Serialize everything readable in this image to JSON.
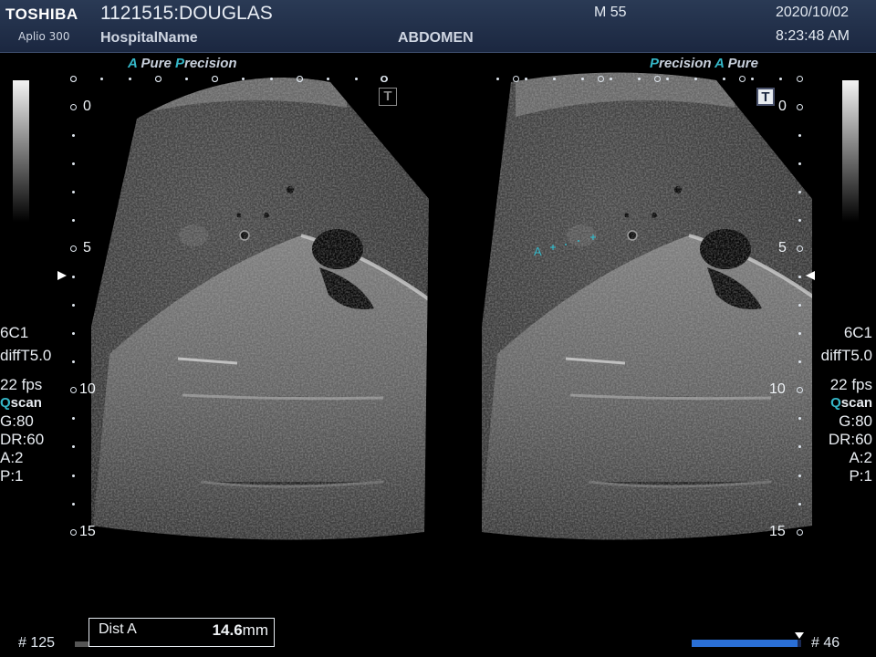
{
  "header": {
    "brand": "TOSHIBA",
    "model": "Aplio 300",
    "patient": "1121515:DOUGLAS",
    "hospital": "HospitalName",
    "exam": "ABDOMEN",
    "index": "M 55",
    "date": "2020/10/02",
    "time": "8:23:48 AM"
  },
  "features": {
    "left_a": "A",
    "left_pure": "Pure",
    "left_p": "P",
    "left_precision": "recision",
    "right_p": "P",
    "right_precision": "recision",
    "right_a": "A",
    "right_pure": "Pure"
  },
  "left_params": {
    "probe": "6C1",
    "mode": "diffT5.0",
    "fps": "22 fps",
    "q": "Q",
    "scan": "scan",
    "gain": "G:80",
    "dr": "DR:60",
    "a": "A:2",
    "p": "P:1"
  },
  "right_params": {
    "probe": "6C1",
    "mode": "diffT5.0",
    "fps": "22 fps",
    "q": "Q",
    "scan": "scan",
    "gain": "G:80",
    "dr": "DR:60",
    "a": "A:2",
    "p": "P:1"
  },
  "depth_scale": {
    "labels": [
      "0",
      "5",
      "10",
      "15"
    ]
  },
  "t_marker": "T",
  "caliper_label": "A",
  "measurement": {
    "label": "Dist A",
    "value": "14.6",
    "unit": "mm"
  },
  "left_frame": "# 125",
  "right_frame": "# 46",
  "cine_progress": 0.97,
  "colors": {
    "header_bg": "#1b2740",
    "accent": "#35b7c8",
    "cine_bar": "#2a6fd6"
  }
}
